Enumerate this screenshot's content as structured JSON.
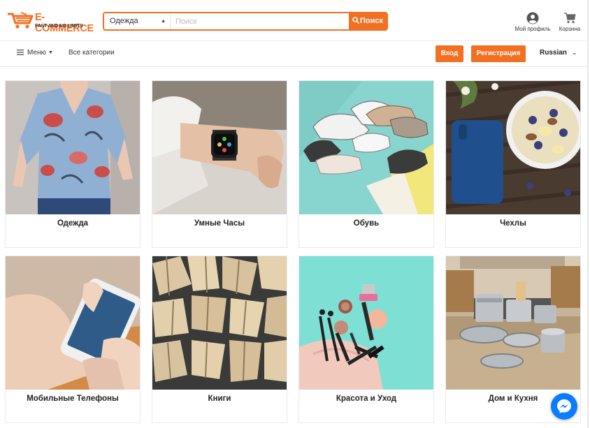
{
  "brand": {
    "title": "E-COMMERCE",
    "subtitle": "FAST AND NO LIMITS",
    "accent_color": "#f36f21"
  },
  "search": {
    "category_selected": "Одежда",
    "placeholder": "Поиск",
    "button_label": "Поиск",
    "button_icon": "search-icon"
  },
  "header": {
    "profile_label": "Мой профиль",
    "profile_icon": "user-circle-icon",
    "cart_label": "Корзина",
    "cart_icon": "shopping-cart-icon"
  },
  "nav": {
    "menu_label": "Меню",
    "all_categories_label": "Все категории",
    "login_label": "Вход",
    "register_label": "Регистрация",
    "language": "Russian"
  },
  "categories": [
    {
      "label": "Одежда",
      "image": "blouse-photo"
    },
    {
      "label": "Умные Часы",
      "image": "smartwatch-photo"
    },
    {
      "label": "Обувь",
      "image": "sneakers-photo"
    },
    {
      "label": "Чехлы",
      "image": "phone-case-photo"
    },
    {
      "label": "Мобильные Телефоны",
      "image": "smartphone-photo"
    },
    {
      "label": "Книги",
      "image": "books-photo"
    },
    {
      "label": "Красота и Уход",
      "image": "cosmetics-photo"
    },
    {
      "label": "Дом и Кухня",
      "image": "kitchen-photo"
    }
  ],
  "chat": {
    "icon": "messenger-icon",
    "color": "#0a7cff"
  }
}
